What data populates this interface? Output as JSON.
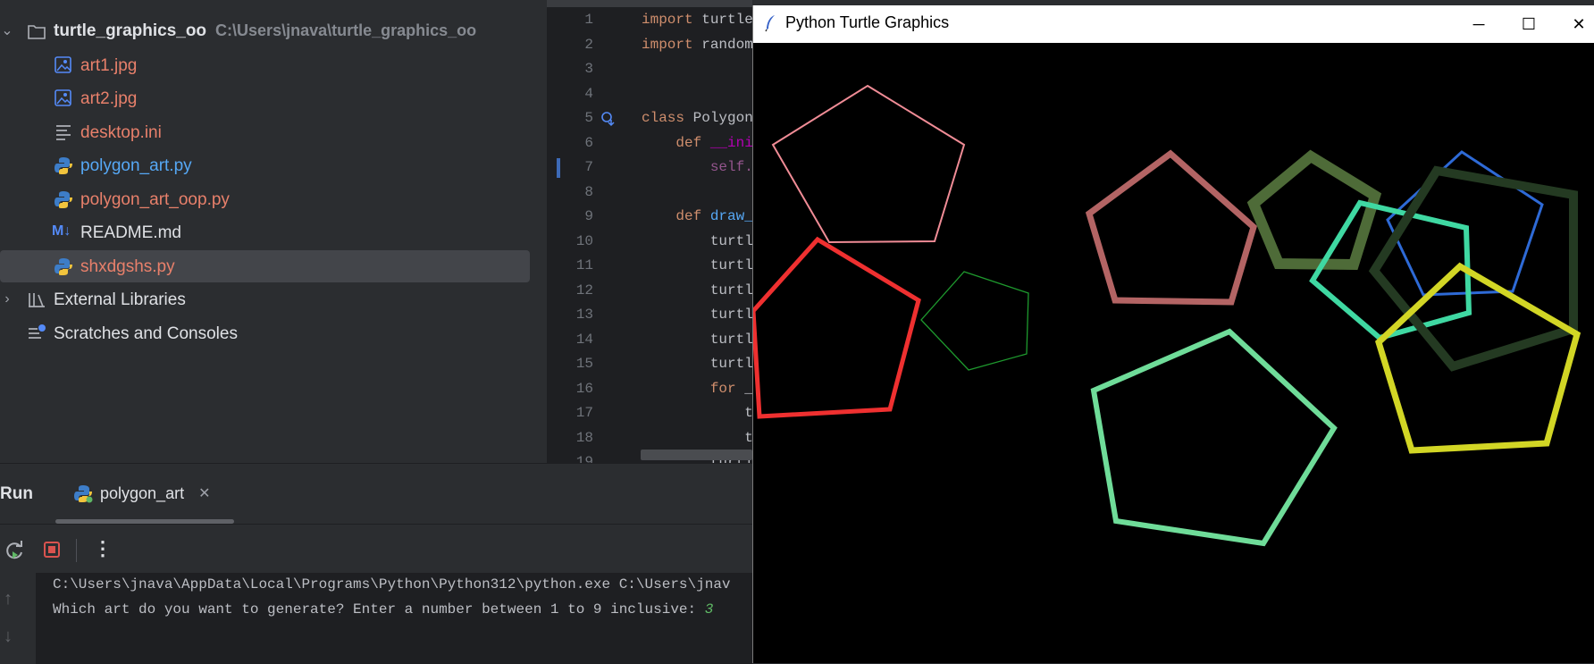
{
  "project": {
    "root_name": "turtle_graphics_oo",
    "root_path": "C:\\Users\\jnava\\turtle_graphics_oo",
    "files": [
      {
        "name": "art1.jpg",
        "icon": "image-file-icon",
        "color": "#e8806b"
      },
      {
        "name": "art2.jpg",
        "icon": "image-file-icon",
        "color": "#e8806b"
      },
      {
        "name": "desktop.ini",
        "icon": "text-file-icon",
        "color": "#e8806b"
      },
      {
        "name": "polygon_art.py",
        "icon": "python-file-icon",
        "color": "#56a8f5"
      },
      {
        "name": "polygon_art_oop.py",
        "icon": "python-file-icon",
        "color": "#e8806b"
      },
      {
        "name": "README.md",
        "icon": "markdown-file-icon",
        "color": "#dfe1e5"
      },
      {
        "name": "shxdgshs.py",
        "icon": "python-file-icon",
        "color": "#e8806b"
      }
    ],
    "external_libraries": "External Libraries",
    "scratches": "Scratches and Consoles"
  },
  "editor": {
    "line_numbers": [
      "1",
      "2",
      "3",
      "4",
      "5",
      "6",
      "7",
      "8",
      "9",
      "10",
      "11",
      "12",
      "13",
      "14",
      "15",
      "16",
      "17",
      "18",
      "19"
    ],
    "lines": [
      "import turtle",
      "import random",
      "",
      "",
      "class Polygon",
      "    def __init",
      "        self.",
      "",
      "    def draw_",
      "        turtl",
      "        turtl",
      "        turtl",
      "        turtl",
      "        turtl",
      "        turtl",
      "        for _",
      "            t",
      "            t",
      "        turtl"
    ]
  },
  "run": {
    "title": "Run",
    "tab_label": "polygon_art",
    "console_lines": [
      "C:\\Users\\jnava\\AppData\\Local\\Programs\\Python\\Python312\\python.exe C:\\Users\\jnav"
    ],
    "prompt": "Which art do you want to generate? Enter a number between 1 to 9 inclusive: ",
    "user_input": "3"
  },
  "turtle_window": {
    "title": "Python Turtle Graphics",
    "minimize": "─",
    "maximize": "☐",
    "close": "✕",
    "background": "#000000",
    "shapes": [
      {
        "name": "pink-pentagon",
        "color": "#f08c96"
      },
      {
        "name": "red-pentagon",
        "color": "#ef3030"
      },
      {
        "name": "green-pentagon",
        "color": "#1e9a2e"
      },
      {
        "name": "rose-pentagon",
        "color": "#b36464"
      },
      {
        "name": "olive-pentagon",
        "color": "#4e6b38"
      },
      {
        "name": "blue-pentagon",
        "color": "#2e6ad6"
      },
      {
        "name": "aqua-pentagon",
        "color": "#3fd8a2"
      },
      {
        "name": "darkgreen-pentagon",
        "color": "#243a22"
      },
      {
        "name": "yellow-pentagon",
        "color": "#d2d625"
      },
      {
        "name": "mint-pentagon",
        "color": "#6fdc99"
      }
    ]
  }
}
